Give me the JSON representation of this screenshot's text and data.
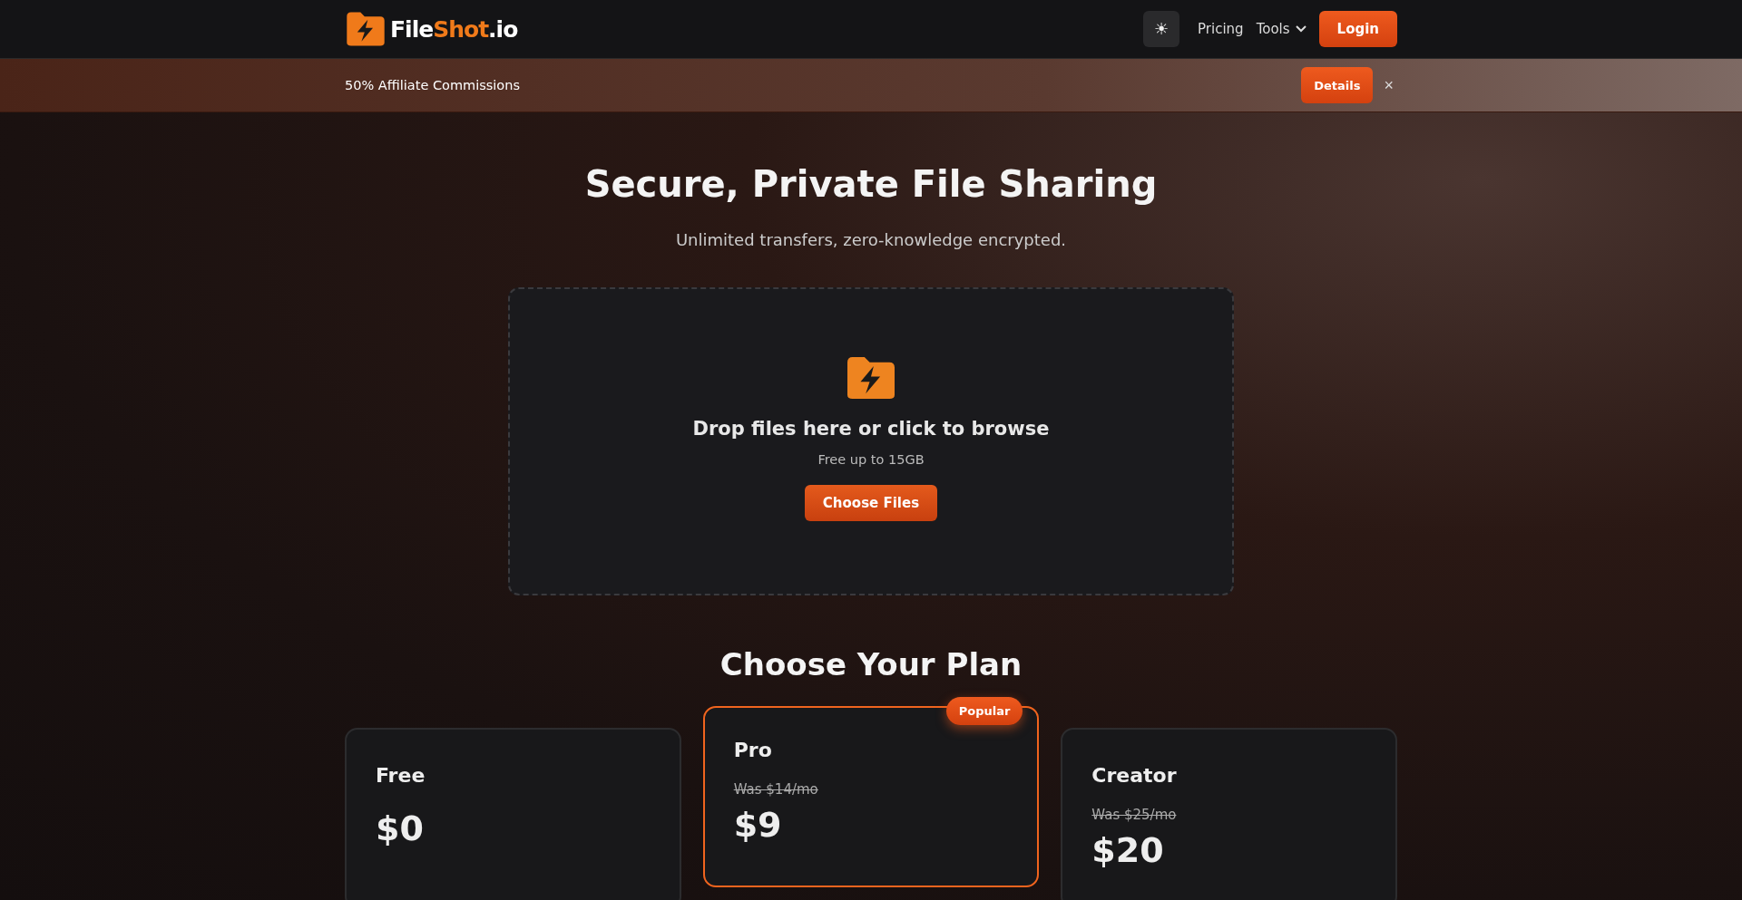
{
  "header": {
    "logo": [
      {
        "text": "File",
        "accent": false
      },
      {
        "text": "Shot",
        "accent": true
      },
      {
        "text": ".io",
        "accent": false
      }
    ],
    "theme_toggle": "☀",
    "nav": [
      {
        "label": "Pricing",
        "kind": "link"
      },
      {
        "label": "Tools",
        "kind": "dropdown"
      }
    ],
    "login": "Login"
  },
  "banner": {
    "text": "50% Affiliate Commissions",
    "button": "Details",
    "close": "×"
  },
  "hero": {
    "title": "Secure, Private File Sharing",
    "subtitle": "Unlimited transfers, zero-knowledge encrypted."
  },
  "dropzone": {
    "title": "Drop files here or click to browse",
    "note": "Free up to 15GB",
    "button": "Choose Files"
  },
  "plans": {
    "title": "Choose Your Plan",
    "items": [
      {
        "name": "Free",
        "price": "$0",
        "popular": false
      },
      {
        "name": "Pro",
        "was": "Was $14/mo",
        "price": "$9",
        "popular": true,
        "badge": "Popular"
      },
      {
        "name": "Creator",
        "was": "Was $25/mo",
        "price": "$20",
        "popular": false
      }
    ]
  }
}
